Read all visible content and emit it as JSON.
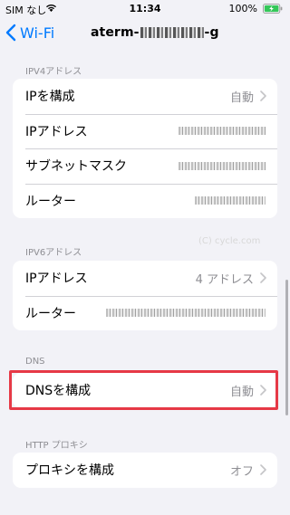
{
  "status_bar": {
    "carrier": "SIM なし",
    "time": "11:34",
    "battery": "100%"
  },
  "nav": {
    "back_label": "Wi-Fi",
    "title_prefix": "aterm-",
    "title_suffix": "-g"
  },
  "ipv4": {
    "header": "IPV4アドレス",
    "rows": [
      {
        "label": "IPを構成",
        "value": "自動"
      },
      {
        "label": "IPアドレス"
      },
      {
        "label": "サブネットマスク"
      },
      {
        "label": "ルーター"
      }
    ]
  },
  "ipv6": {
    "header": "IPV6アドレス",
    "rows": [
      {
        "label": "IPアドレス",
        "value": "4 アドレス"
      },
      {
        "label": "ルーター"
      }
    ]
  },
  "dns": {
    "header": "DNS",
    "rows": [
      {
        "label": "DNSを構成",
        "value": "自動"
      }
    ]
  },
  "proxy": {
    "header": "HTTP プロキシ",
    "rows": [
      {
        "label": "プロキシを構成",
        "value": "オフ"
      }
    ]
  },
  "watermark": "(C) cycle.com",
  "colors": {
    "accent": "#007aff",
    "highlight": "#e63946",
    "background": "#f2f2f7",
    "battery": "#34c759"
  }
}
